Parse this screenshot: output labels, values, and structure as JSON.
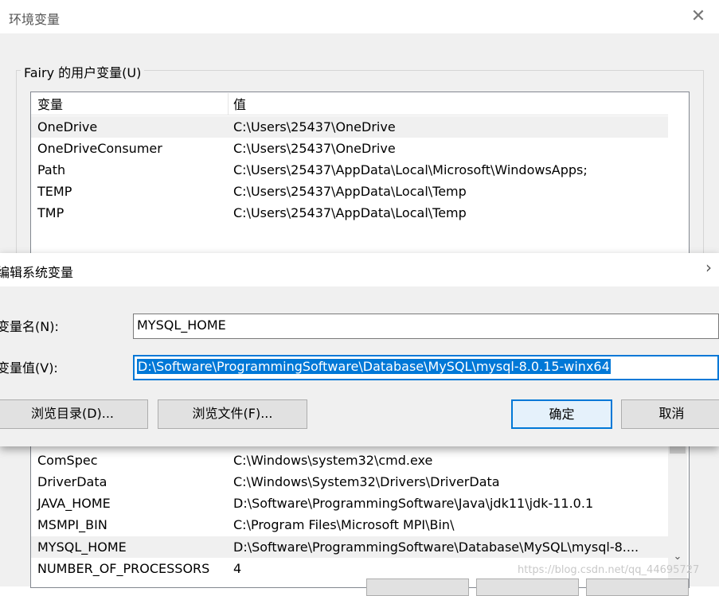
{
  "outer_dialog": {
    "title": "环境变量",
    "close_icon": "close-icon",
    "user_group_label": "Fairy 的用户变量(U)",
    "columns": {
      "variable": "变量",
      "value": "值"
    },
    "user_rows": [
      {
        "name": "OneDrive",
        "value": "C:\\Users\\25437\\OneDrive"
      },
      {
        "name": "OneDriveConsumer",
        "value": "C:\\Users\\25437\\OneDrive"
      },
      {
        "name": "Path",
        "value": "C:\\Users\\25437\\AppData\\Local\\Microsoft\\WindowsApps;"
      },
      {
        "name": "TEMP",
        "value": "C:\\Users\\25437\\AppData\\Local\\Temp"
      },
      {
        "name": "TMP",
        "value": "C:\\Users\\25437\\AppData\\Local\\Temp"
      }
    ],
    "system_rows": [
      {
        "name": "ComSpec",
        "value": "C:\\Windows\\system32\\cmd.exe"
      },
      {
        "name": "DriverData",
        "value": "C:\\Windows\\System32\\Drivers\\DriverData"
      },
      {
        "name": "JAVA_HOME",
        "value": "D:\\Software\\ProgrammingSoftware\\Java\\jdk11\\jdk-11.0.1"
      },
      {
        "name": "MSMPI_BIN",
        "value": "C:\\Program Files\\Microsoft MPI\\Bin\\"
      },
      {
        "name": "MYSQL_HOME",
        "value": "D:\\Software\\ProgrammingSoftware\\Database\\MySQL\\mysql-8...."
      },
      {
        "name": "NUMBER_OF_PROCESSORS",
        "value": "4"
      }
    ]
  },
  "edit_dialog": {
    "title": "编辑系统变量",
    "close_icon": "chevron-right-icon",
    "name_label": "变量名(N):",
    "value_label": "变量值(V):",
    "name_value": "MYSQL_HOME",
    "value_value": "D:\\Software\\ProgrammingSoftware\\Database\\MySQL\\mysql-8.0.15-winx64",
    "browse_dir_label": "浏览目录(D)...",
    "browse_file_label": "浏览文件(F)...",
    "ok_label": "确定",
    "cancel_label": "取消"
  },
  "watermark": "https://blog.csdn.net/qq_44695727",
  "colors": {
    "accent": "#0078d7",
    "selection_bg": "#0078d7",
    "dialog_bg": "#f0f0f0"
  }
}
